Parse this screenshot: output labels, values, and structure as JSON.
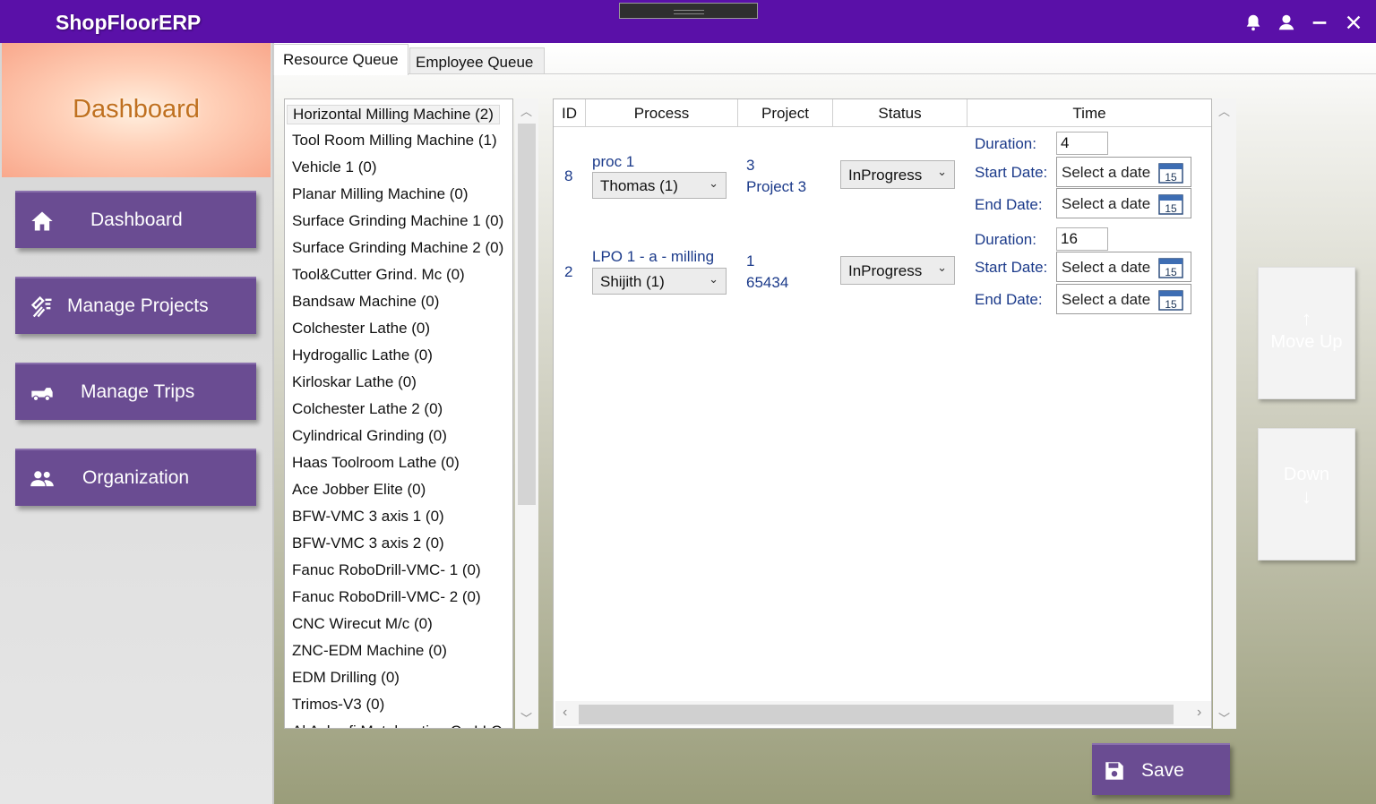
{
  "app": {
    "title": "ShopFloorERP"
  },
  "titlebar_icons": [
    "bell-icon",
    "user-icon",
    "minimize-icon",
    "close-icon"
  ],
  "sidebar": {
    "header_title": "Dashboard",
    "nav": [
      {
        "label": "Dashboard",
        "icon": "home-icon"
      },
      {
        "label": "Manage Projects",
        "icon": "projects-icon"
      },
      {
        "label": "Manage Trips",
        "icon": "truck-icon"
      },
      {
        "label": "Organization",
        "icon": "people-icon"
      }
    ]
  },
  "tabs": [
    {
      "label": "Resource Queue",
      "active": true
    },
    {
      "label": "Employee Queue",
      "active": false
    }
  ],
  "resources": [
    "Horizontal Milling Machine (2)",
    "Tool Room Milling Machine (1)",
    "Vehicle 1 (0)",
    "Planar Milling Machine (0)",
    "Surface Grinding Machine 1 (0)",
    "Surface Grinding Machine 2 (0)",
    "Tool&Cutter Grind. Mc (0)",
    "Bandsaw Machine (0)",
    "Colchester Lathe (0)",
    "Hydrogallic Lathe (0)",
    "Kirloskar Lathe (0)",
    "Colchester Lathe 2 (0)",
    "Cylindrical Grinding (0)",
    "Haas Toolroom Lathe (0)",
    "Ace Jobber Elite (0)",
    "BFW-VMC 3 axis 1 (0)",
    "BFW-VMC 3 axis 2 (0)",
    "Fanuc RoboDrill-VMC- 1 (0)",
    "Fanuc RoboDrill-VMC- 2 (0)",
    "CNC Wirecut M/c (0)",
    "ZNC-EDM Machine (0)",
    "EDM Drilling (0)",
    "Trimos-V3 (0)",
    "Al Ashrafi Metalcasting Co LLC"
  ],
  "selected_resource": "Horizontal Milling Machine (2)",
  "grid": {
    "headers": {
      "id": "ID",
      "process": "Process",
      "project": "Project",
      "status": "Status",
      "time": "Time"
    },
    "time_labels": {
      "duration": "Duration:",
      "start": "Start Date:",
      "end": "End Date:"
    },
    "rows": [
      {
        "id": "8",
        "process": "proc 1",
        "employee": "Thomas (1)",
        "project_no": "3",
        "project_name": "Project 3",
        "status": "InProgress",
        "duration": "4",
        "start_date": "Select a date",
        "end_date": "Select a date"
      },
      {
        "id": "2",
        "process": "LPO 1 - a - milling",
        "employee": "Shijith (1)",
        "project_no": "1",
        "project_name": "65434",
        "status": "InProgress",
        "duration": "16",
        "start_date": "Select a date",
        "end_date": "Select a date"
      }
    ],
    "calendar_day": "15"
  },
  "move_up": {
    "label": "Move Up",
    "arrow": "↑"
  },
  "move_down": {
    "label": "Down",
    "arrow": "↓"
  },
  "save": {
    "label": "Save",
    "icon": "save-icon"
  },
  "colors": {
    "titlebar": "#5a10a8",
    "nav_button": "#6a4c92",
    "link_text": "#1b3a8a",
    "dashboard_title": "#c07020"
  }
}
